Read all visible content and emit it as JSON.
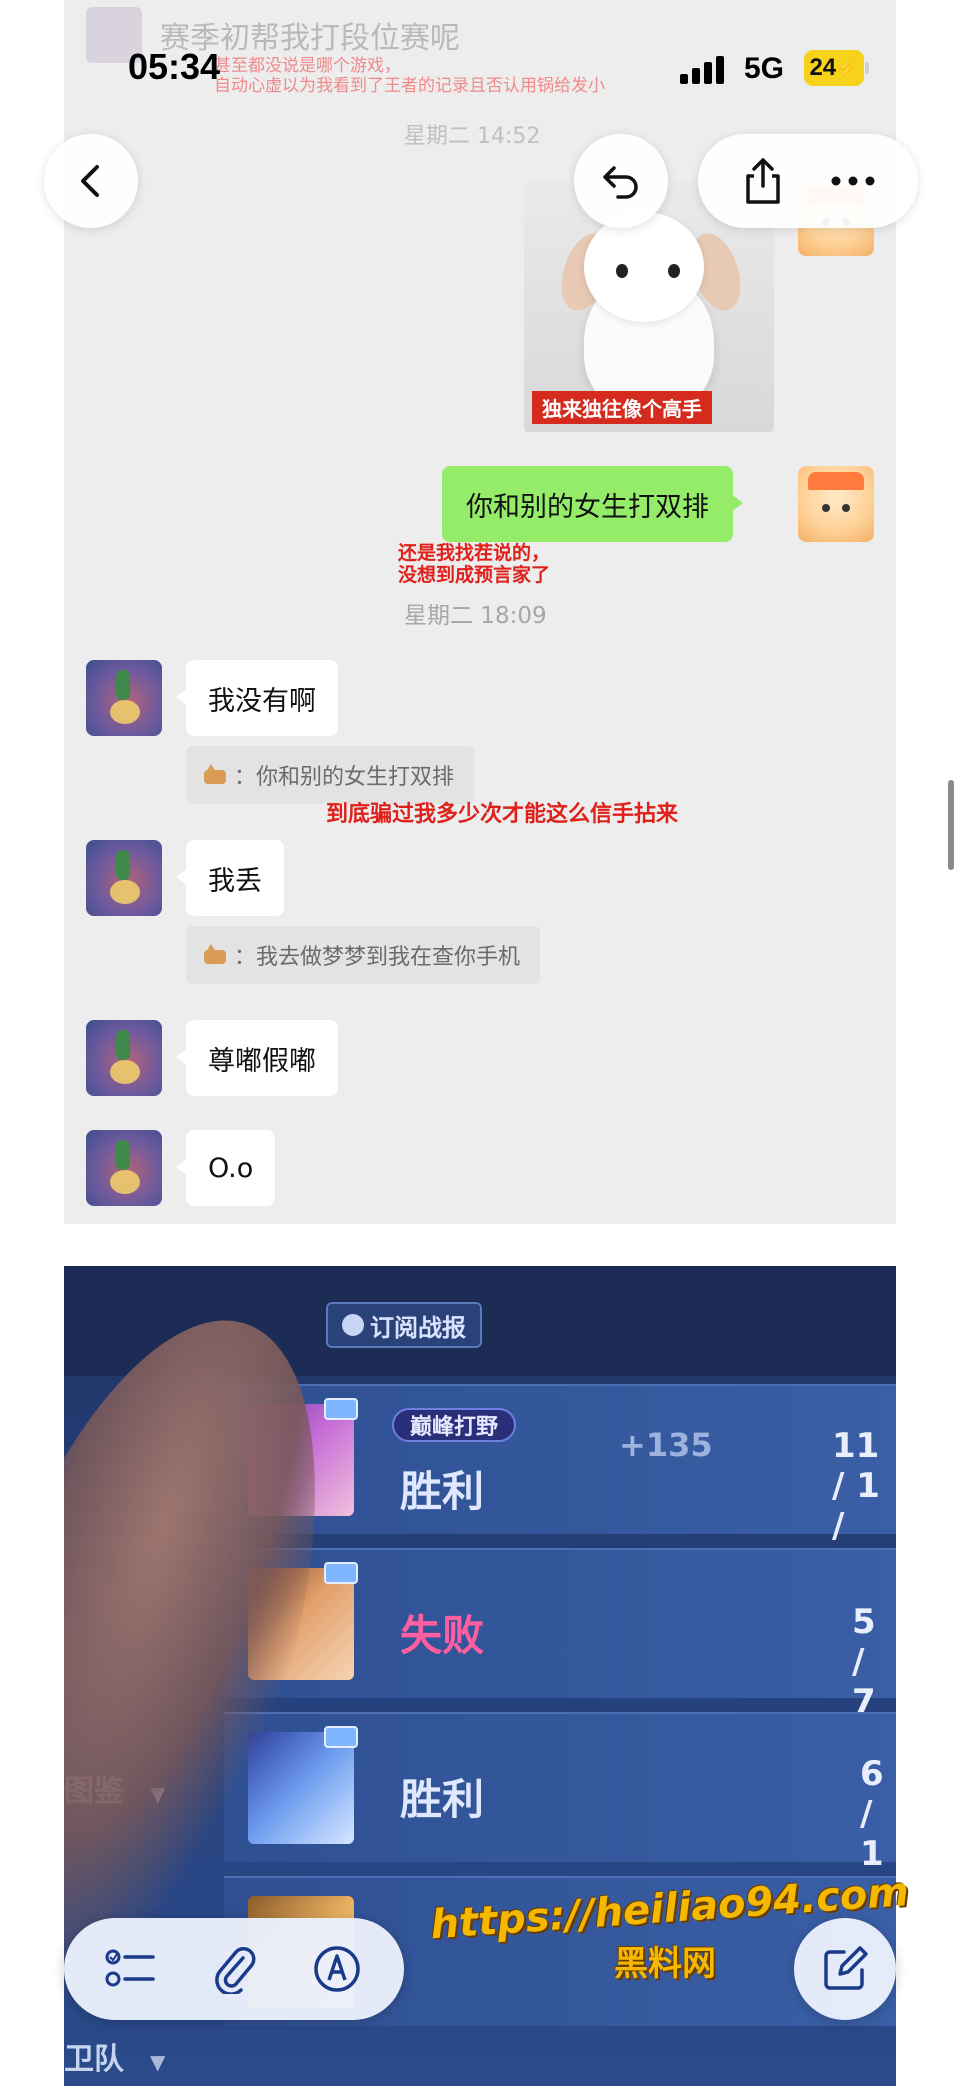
{
  "status_bar": {
    "time": "05:34",
    "network": "5G",
    "battery": "24"
  },
  "chat": {
    "faded_top_message": "赛季初帮我打段位赛呢",
    "faded_note_line1": "甚至都没说是哪个游戏，",
    "faded_note_line2": "自动心虚以为我看到了王者的记录且否认用锅给发小",
    "faded_time": "星期二 14:52",
    "sticker_caption": "独来独往像个高手",
    "my_message": "你和别的女生打双排",
    "red_note_1_line1": "还是我找茬说的，",
    "red_note_1_line2": "没想到成预言家了",
    "time_1": "星期二 18:09",
    "reply_1": "我没有啊",
    "quote_1": "：你和别的女生打双排",
    "red_note_2": "到底骗过我多少次才能这么信手拈来",
    "reply_2": "我丢",
    "quote_2": "：我去做梦梦到我在查你手机",
    "reply_3": "尊嘟假嘟",
    "reply_4": "O.o"
  },
  "game": {
    "tab_label": "订阅战报",
    "mode_tag": "巅峰打野",
    "rows": [
      {
        "result": "胜利",
        "result_color": "#dfe8ff",
        "score": "+135",
        "kda": "11 / 1 /"
      },
      {
        "result": "失败",
        "result_color": "#ff5ea0",
        "score": "",
        "kda": "5 / 7 /"
      },
      {
        "result": "胜利",
        "result_color": "#dfe8ff",
        "score": "",
        "kda": "6 / 1"
      }
    ],
    "side_labels": [
      "图鉴",
      "卫队"
    ]
  },
  "watermark": {
    "url": "https://heiliao94.com",
    "name": "黑料网"
  }
}
